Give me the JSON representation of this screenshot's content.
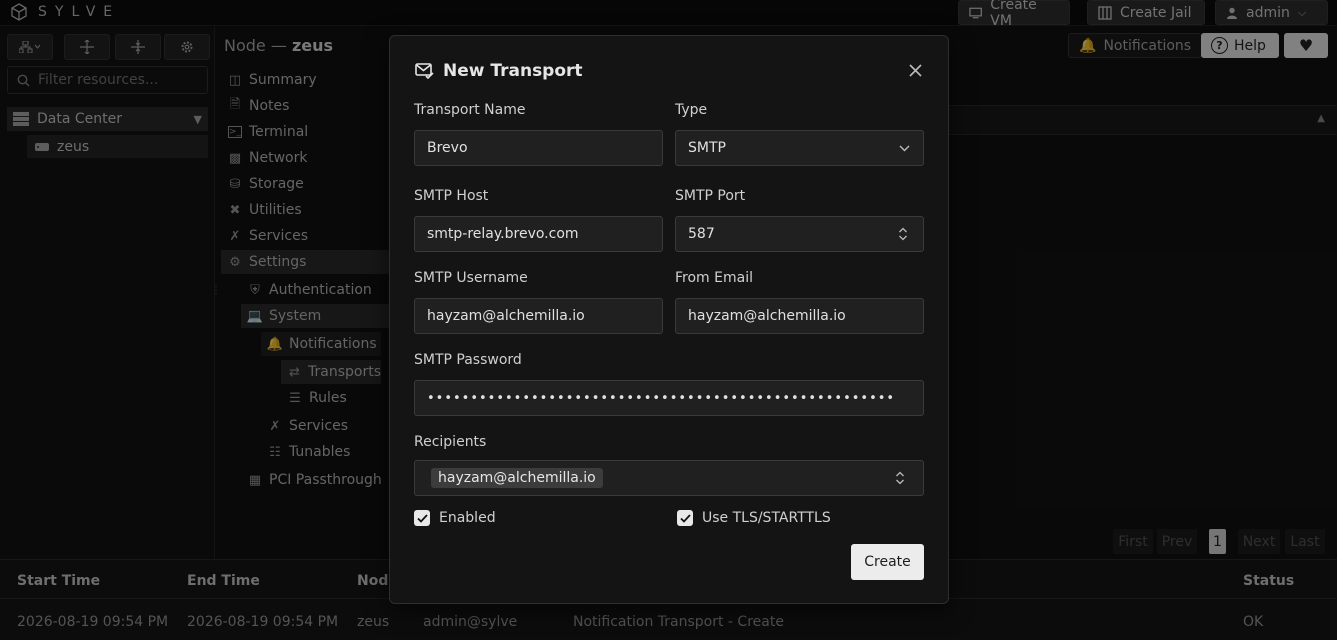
{
  "topbar": {
    "logo_text": "SYLVE",
    "create_vm": "Create VM",
    "create_jail": "Create Jail",
    "user": "admin"
  },
  "sidebar": {
    "filter_placeholder": "Filter resources...",
    "datacenter": "Data Center",
    "node": "zeus"
  },
  "node_header": {
    "prefix": "Node —",
    "name": "zeus"
  },
  "nav": {
    "summary": "Summary",
    "notes": "Notes",
    "terminal": "Terminal",
    "network": "Network",
    "storage": "Storage",
    "utilities": "Utilities",
    "services": "Services",
    "settings": "Settings",
    "authentication": "Authentication",
    "system": "System",
    "notifications": "Notifications",
    "transports": "Transports",
    "rules": "Rules",
    "sys_services": "Services",
    "tunables": "Tunables",
    "pci": "PCI Passthrough"
  },
  "right_header": {
    "notifications": "Notifications",
    "help": "Help"
  },
  "pagination": {
    "first": "First",
    "prev": "Prev",
    "page": "1",
    "next": "Next",
    "last": "Last"
  },
  "tasks": {
    "headers": {
      "start": "Start Time",
      "end": "End Time",
      "node": "Node",
      "status": "Status"
    },
    "row": {
      "start": "2026-08-19 09:54 PM",
      "end": "2026-08-19 09:54 PM",
      "node": "zeus",
      "user": "admin@sylve",
      "description": "Notification Transport - Create",
      "status": "OK"
    }
  },
  "modal": {
    "title": "New Transport",
    "transport_name_label": "Transport Name",
    "transport_name_value": "Brevo",
    "type_label": "Type",
    "type_value": "SMTP",
    "smtp_host_label": "SMTP Host",
    "smtp_host_value": "smtp-relay.brevo.com",
    "smtp_port_label": "SMTP Port",
    "smtp_port_value": "587",
    "smtp_username_label": "SMTP Username",
    "smtp_username_value": "hayzam@alchemilla.io",
    "from_email_label": "From Email",
    "from_email_value": "hayzam@alchemilla.io",
    "smtp_password_label": "SMTP Password",
    "smtp_password_value": "••••••••••••••••••••••••••••••••••••••••••••••••••••••",
    "recipients_label": "Recipients",
    "recipient_chip": "hayzam@alchemilla.io",
    "enabled_label": "Enabled",
    "enabled": true,
    "tls_label": "Use TLS/STARTTLS",
    "tls": true,
    "create_button": "Create"
  }
}
